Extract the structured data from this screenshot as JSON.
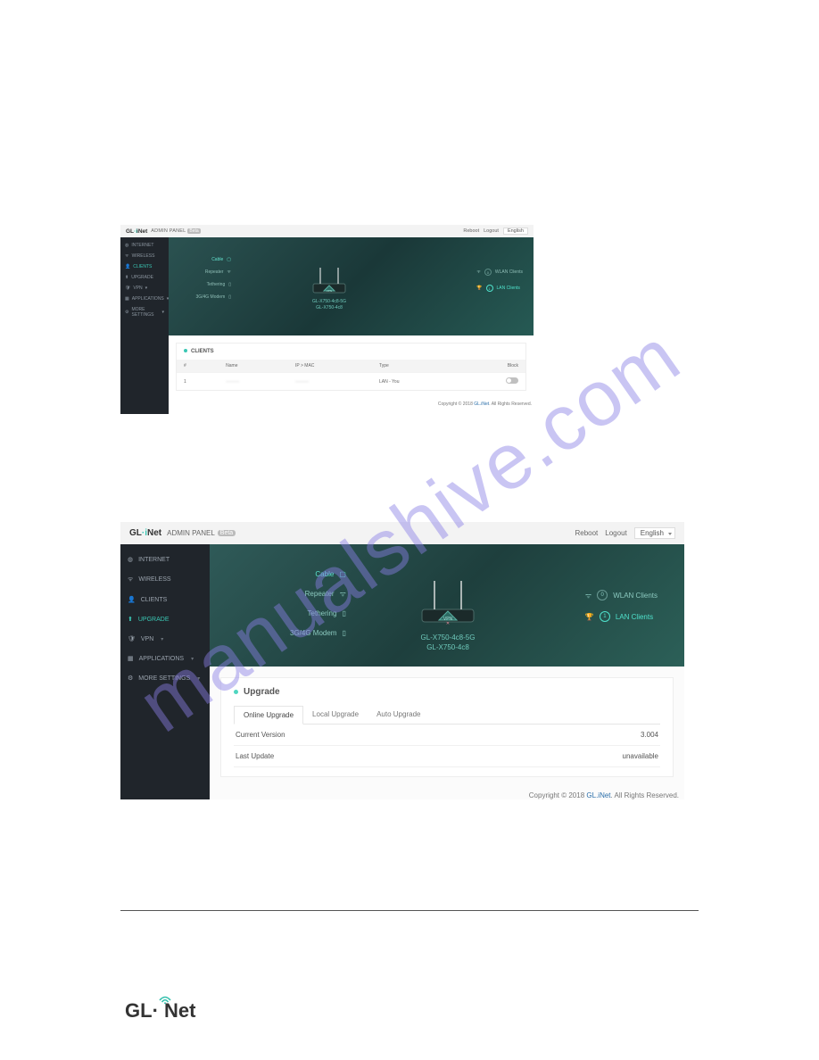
{
  "brand": {
    "name_a": "GL",
    "name_b": "iNet",
    "admin_panel": "ADMIN PANEL",
    "beta": "Beta"
  },
  "topbar": {
    "reboot": "Reboot",
    "logout": "Logout",
    "language": "English"
  },
  "sidebar": {
    "items": [
      {
        "label": "INTERNET",
        "icon": "globe-icon"
      },
      {
        "label": "WIRELESS",
        "icon": "wifi-icon"
      },
      {
        "label": "CLIENTS",
        "icon": "user-icon"
      },
      {
        "label": "UPGRADE",
        "icon": "up-icon"
      },
      {
        "label": "VPN",
        "icon": "shield-icon",
        "caret": true
      },
      {
        "label": "APPLICATIONS",
        "icon": "grid-icon",
        "caret": true
      },
      {
        "label": "MORE SETTINGS",
        "icon": "gear-icon",
        "caret": true
      }
    ]
  },
  "hero": {
    "connections": [
      {
        "label": "Cable",
        "highlight": true
      },
      {
        "label": "Repeater"
      },
      {
        "label": "Tethering"
      },
      {
        "label": "3G/4G Modem"
      }
    ],
    "router_names": [
      "GL-X750-4c8-5G",
      "GL-X750-4c8"
    ],
    "wlan_label": "WLAN Clients",
    "wlan_count": "0",
    "lan_label": "LAN Clients",
    "lan_count": "1"
  },
  "panel1": {
    "card_title": "CLIENTS",
    "table": {
      "cols": [
        "#",
        "Name",
        "IP > MAC",
        "Type",
        "Block"
      ],
      "rows": [
        {
          "idx": "1",
          "name": "———",
          "ipmac": "———",
          "type": "LAN - You"
        }
      ]
    }
  },
  "panel2": {
    "card_title": "Upgrade",
    "tabs": [
      {
        "label": "Online Upgrade",
        "active": true
      },
      {
        "label": "Local Upgrade"
      },
      {
        "label": "Auto Upgrade"
      }
    ],
    "rows": [
      {
        "k": "Current Version",
        "v": "3.004"
      },
      {
        "k": "Last Update",
        "v": "unavailable"
      }
    ]
  },
  "footer": {
    "copyright_a": "Copyright © 2018 ",
    "copyright_link": "GL.iNet",
    "copyright_b": ". All Rights Reserved."
  },
  "watermark": "manualshive.com"
}
